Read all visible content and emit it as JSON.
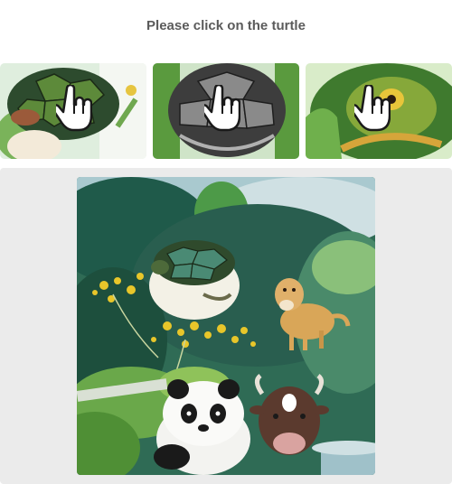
{
  "captcha": {
    "prompt": "Please click on the turtle"
  },
  "examples": [
    {
      "subject": "turtle shell closeup (green/brown)",
      "icon": "hand-pointer-icon"
    },
    {
      "subject": "turtle shell closeup (gray)",
      "icon": "hand-pointer-icon"
    },
    {
      "subject": "turtle head closeup (green)",
      "icon": "hand-pointer-icon"
    }
  ],
  "scene": {
    "objects": [
      "turtle",
      "dog",
      "panda",
      "cow"
    ]
  },
  "colors": {
    "title": "#5b5b5b",
    "panel_bg": "#ebebeb",
    "jungle_dark": "#1f5a4a",
    "jungle_light": "#7fb76a",
    "flowers": "#e8c62a"
  }
}
